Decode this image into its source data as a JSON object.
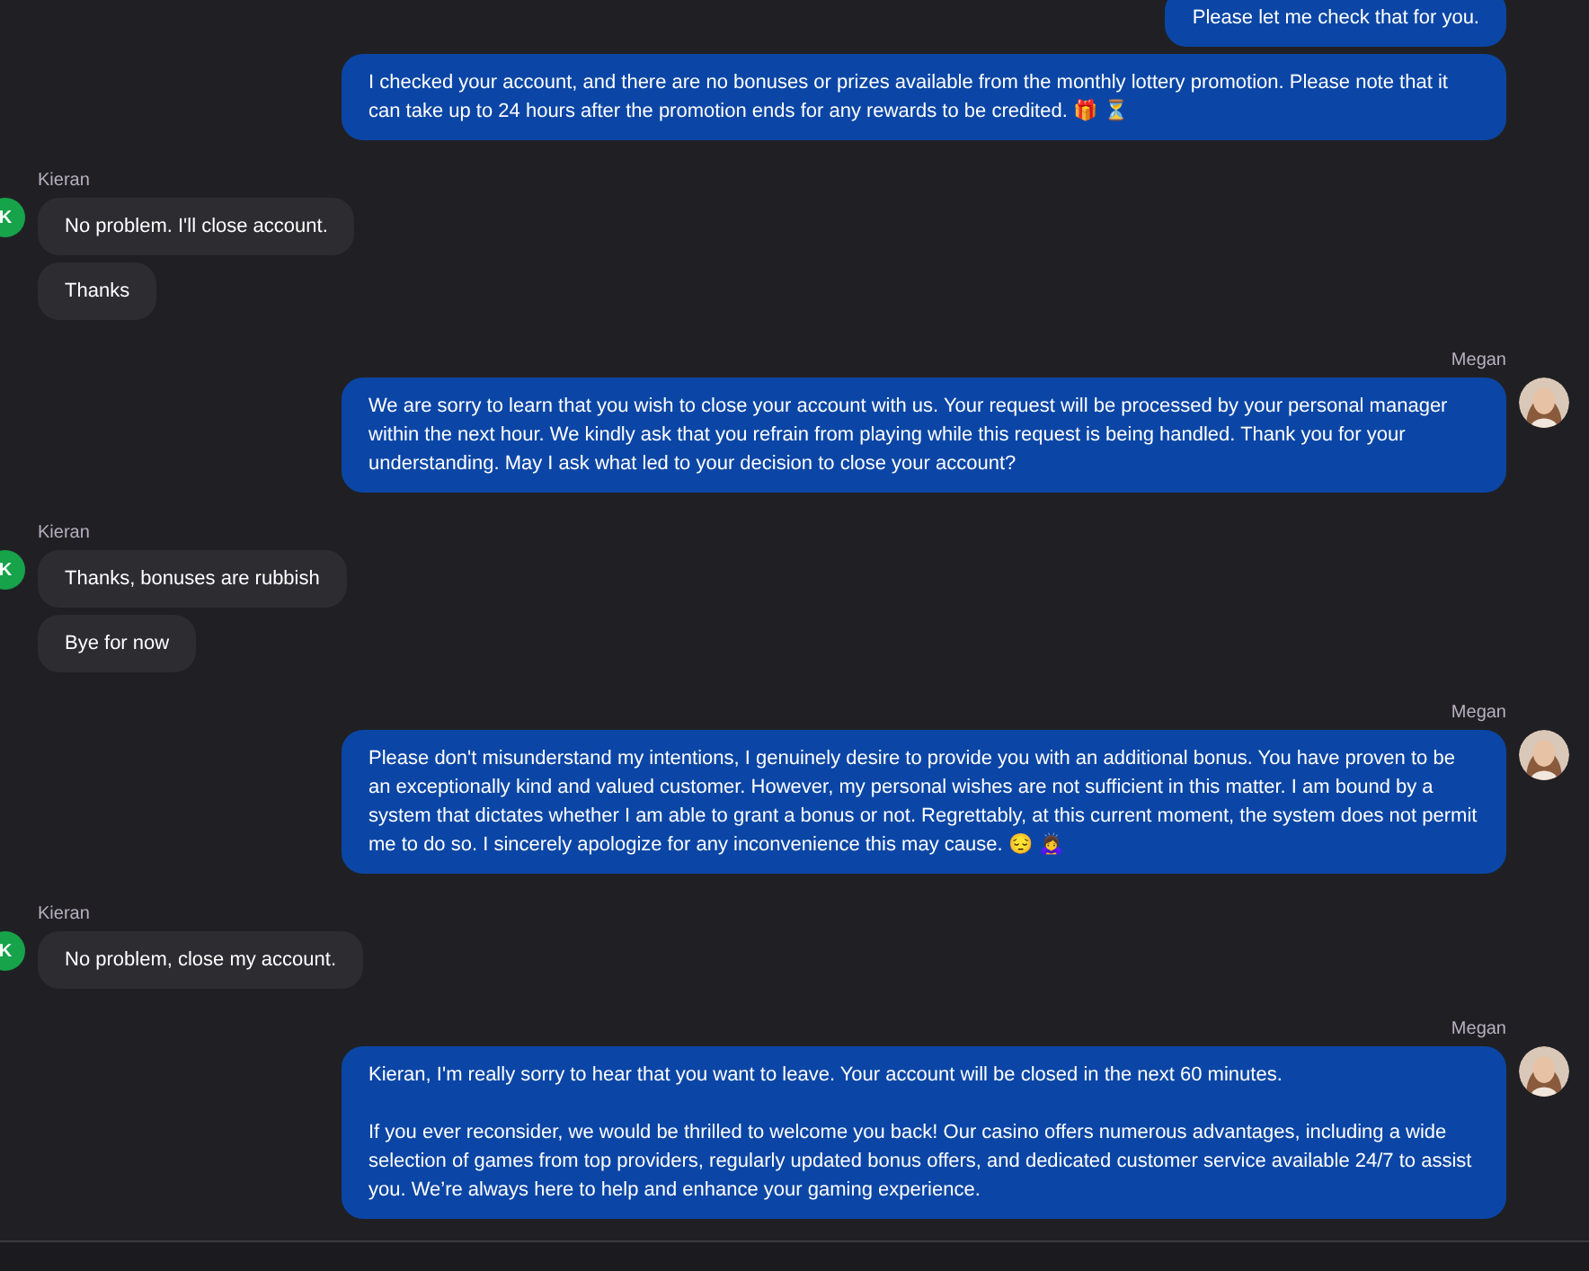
{
  "messages": [
    {
      "kind": "agent",
      "messages": [
        "Please let me check that for you.",
        "I checked your account, and there are no bonuses or prizes available from the monthly lottery promotion. Please note that it can take up to 24 hours after the promotion ends for any rewards to be credited. 🎁 ⏳"
      ]
    },
    {
      "kind": "customer",
      "name": "Kieran",
      "avatar": "K",
      "messages": [
        "No problem. I'll close account.",
        "Thanks"
      ]
    },
    {
      "kind": "agent",
      "name": "Megan",
      "messages": [
        "We are sorry to learn that you wish to close your account with us. Your request will be processed by your personal manager within the next hour. We kindly ask that you refrain from playing while this request is being handled. Thank you for your understanding. May I ask what led to your decision to close your account?"
      ]
    },
    {
      "kind": "customer",
      "name": "Kieran",
      "avatar": "K",
      "messages": [
        "Thanks, bonuses are rubbish",
        "Bye for now"
      ]
    },
    {
      "kind": "agent",
      "name": "Megan",
      "messages": [
        "Please don't misunderstand my intentions, I genuinely desire to provide you with an additional bonus. You have proven to be an exceptionally kind and valued customer. However, my personal wishes are not sufficient in this matter. I am bound by a system that dictates whether I am able to grant a bonus or not. Regrettably, at this current moment, the system does not permit me to do so. I sincerely apologize for any inconvenience this may cause. 😔 🙇‍♀️"
      ]
    },
    {
      "kind": "customer",
      "name": "Kieran",
      "avatar": "K",
      "messages": [
        "No problem, close my account."
      ]
    },
    {
      "kind": "agent",
      "name": "Megan",
      "messages": [
        "Kieran, I'm really sorry to hear that you want to leave. Your account will be closed in the next 60 minutes.\n\nIf you ever reconsider, we would be thrilled to welcome you back! Our casino offers numerous advantages, including a wide selection of games from top providers, regularly updated bonus offers, and dedicated customer service available 24/7 to assist you. We’re always here to help and enhance your gaming experience."
      ]
    }
  ]
}
